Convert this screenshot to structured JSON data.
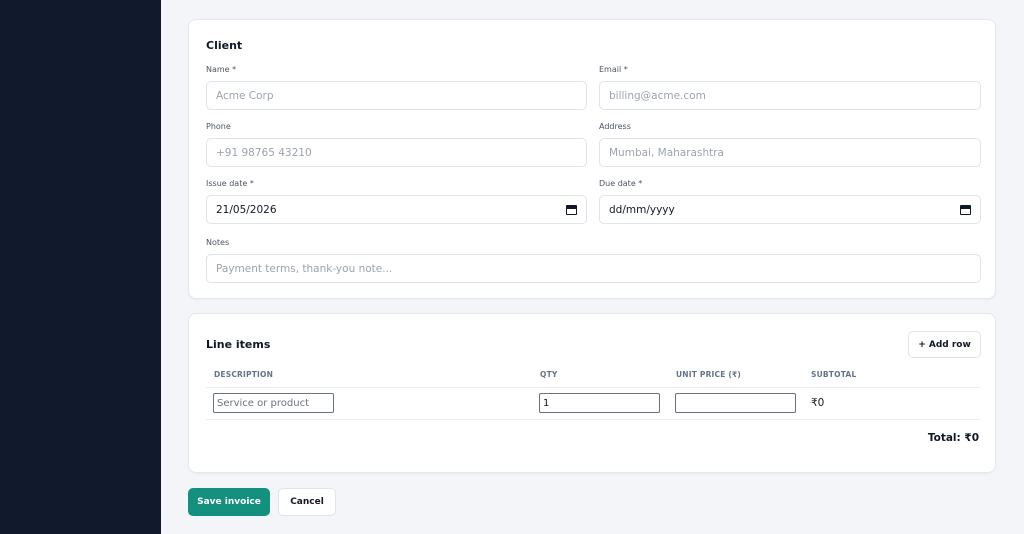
{
  "client": {
    "title": "Client",
    "name": {
      "label": "Name *",
      "placeholder": "Acme Corp"
    },
    "email": {
      "label": "Email *",
      "placeholder": "billing@acme.com"
    },
    "phone": {
      "label": "Phone",
      "placeholder": "+91 98765 43210"
    },
    "address": {
      "label": "Address",
      "placeholder": "Mumbai, Maharashtra"
    },
    "issue_date": {
      "label": "Issue date *",
      "value": "21/05/2026"
    },
    "due_date": {
      "label": "Due date *",
      "value": "dd/mm/yyyy"
    },
    "notes": {
      "label": "Notes",
      "placeholder": "Payment terms, thank-you note..."
    }
  },
  "line_items": {
    "title": "Line items",
    "add_row_label": "+ Add row",
    "columns": [
      "DESCRIPTION",
      "QTY",
      "UNIT PRICE (₹)",
      "SUBTOTAL"
    ],
    "rows": [
      {
        "description_placeholder": "Service or product",
        "qty": "1",
        "unit_price": "",
        "subtotal": "₹0"
      }
    ],
    "total_label": "Total: ₹0"
  },
  "actions": {
    "save_label": "Save invoice",
    "cancel_label": "Cancel"
  },
  "colors": {
    "sidebar": "#111a2c",
    "accent": "#14907e",
    "background": "#f3f5f9"
  }
}
